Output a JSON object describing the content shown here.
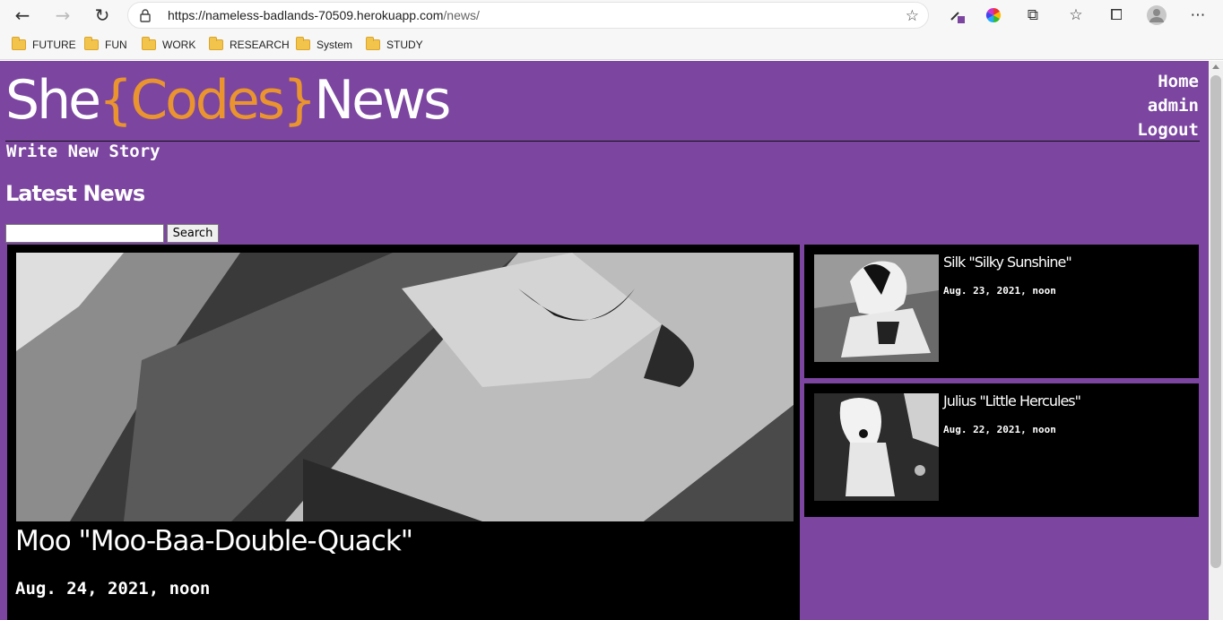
{
  "browser": {
    "url_host": "https://nameless-badlands-70509.herokuapp.com",
    "url_path": "/news/",
    "bookmarks": [
      "FUTURE",
      "FUN",
      "WORK",
      "RESEARCH",
      "System",
      "STUDY"
    ]
  },
  "site": {
    "logo": {
      "part1": "She",
      "part2": "{Codes}",
      "part3": "News"
    },
    "nav": [
      "Home",
      "admin",
      "Logout"
    ],
    "write_link": "Write New Story",
    "section_title": "Latest News",
    "search": {
      "value": "",
      "button": "Search"
    }
  },
  "featured": {
    "title": "Moo \"Moo-Baa-Double-Quack\"",
    "date": "Aug. 24, 2021, noon"
  },
  "stories": [
    {
      "title": "Silk \"Silky Sunshine\"",
      "date": "Aug. 23, 2021, noon"
    },
    {
      "title": "Julius \"Little Hercules\"",
      "date": "Aug. 22, 2021, noon"
    }
  ],
  "colors": {
    "page_bg": "#7b45a0",
    "accent": "#e9942f",
    "card_bg": "#000000"
  }
}
